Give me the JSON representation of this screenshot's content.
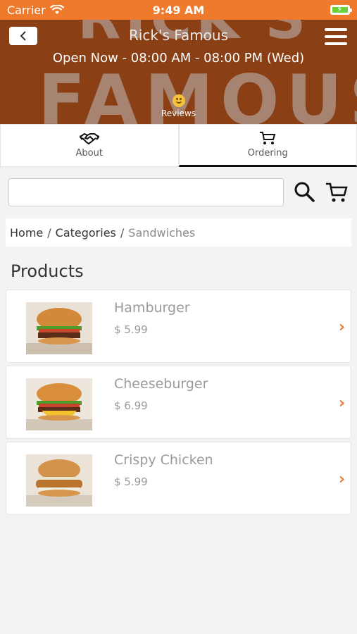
{
  "status_bar": {
    "carrier": "Carrier",
    "time": "9:49 AM"
  },
  "header": {
    "title": "Rick's Famous",
    "hours": "Open Now - 08:00 AM - 08:00 PM (Wed)",
    "reviews_label": "Reviews",
    "background_text_line1": "RICK'S",
    "background_text_line2": "FAMOUS"
  },
  "tabs": [
    {
      "label": "About",
      "icon": "handshake-icon"
    },
    {
      "label": "Ordering",
      "icon": "cart-icon",
      "active": true
    }
  ],
  "search": {
    "value": "",
    "placeholder": ""
  },
  "breadcrumb": {
    "home": "Home",
    "sep1": "/",
    "categories": "Categories",
    "sep2": "/",
    "current": "Sandwiches"
  },
  "products_heading": "Products",
  "products": [
    {
      "name": "Hamburger",
      "price": "$ 5.99",
      "image": "hamburger"
    },
    {
      "name": "Cheeseburger",
      "price": "$ 6.99",
      "image": "cheeseburger"
    },
    {
      "name": "Crispy Chicken",
      "price": "$ 5.99",
      "image": "crispy-chicken-sandwich"
    }
  ],
  "colors": {
    "accent": "#f07a2b",
    "header_bg": "#8a3f14"
  }
}
